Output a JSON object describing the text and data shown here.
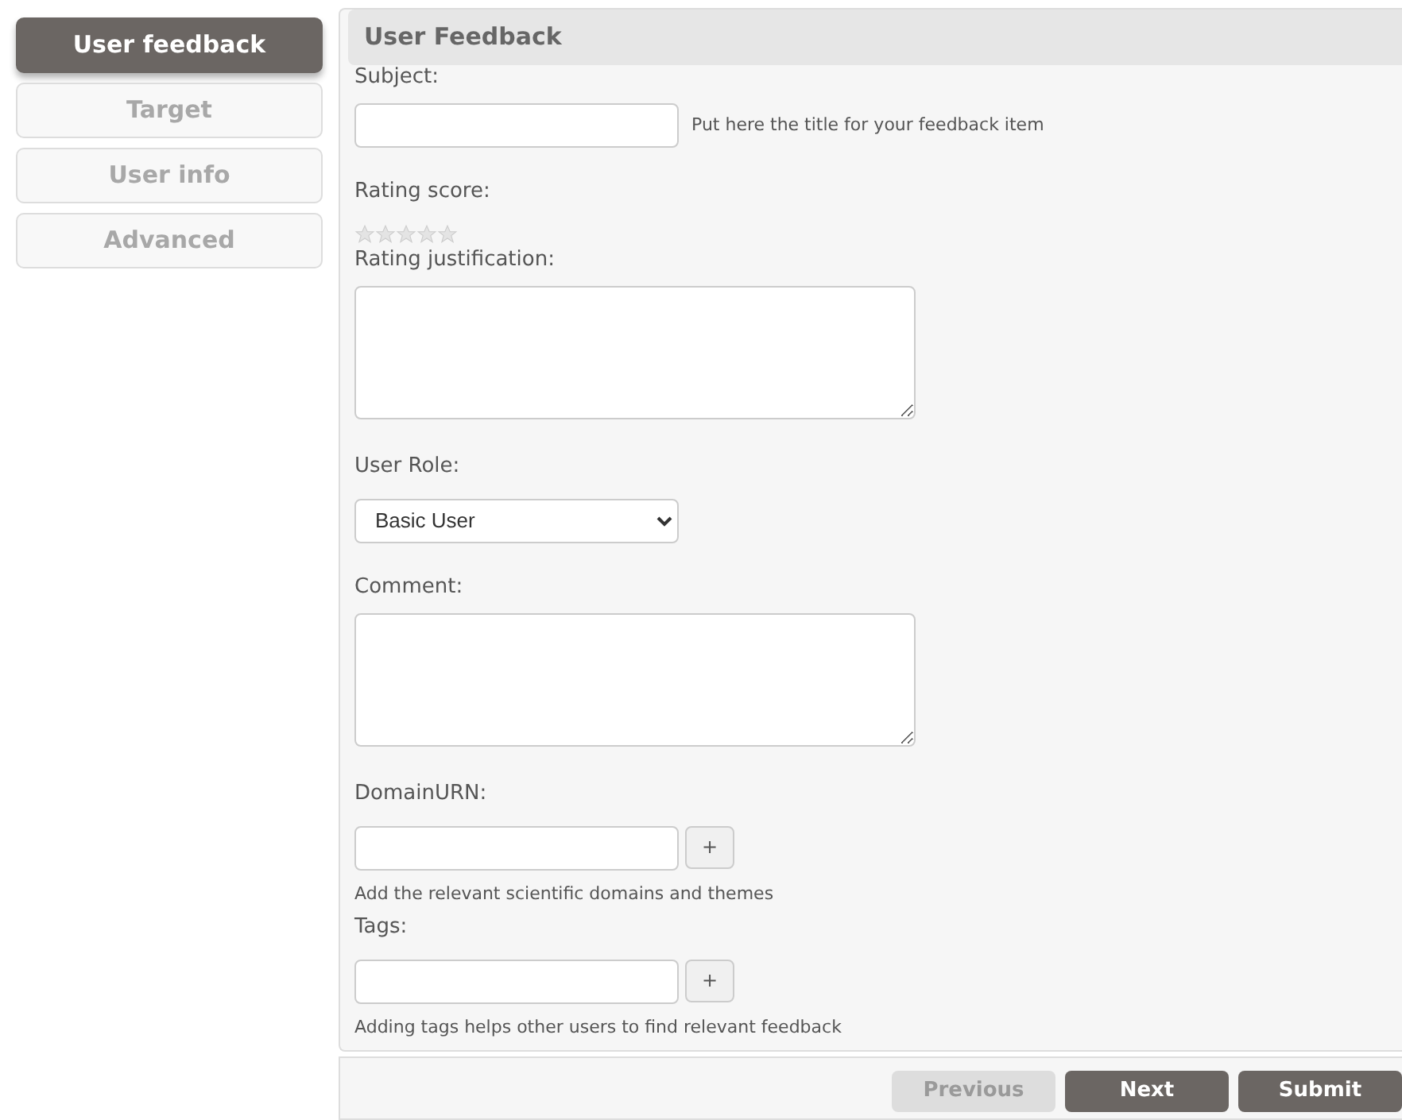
{
  "steps": [
    {
      "label": "User feedback",
      "selected": true
    },
    {
      "label": "Target",
      "selected": false
    },
    {
      "label": "User info",
      "selected": false
    },
    {
      "label": "Advanced",
      "selected": false
    }
  ],
  "panel": {
    "title": "User Feedback"
  },
  "fields": [
    {
      "kind": "text",
      "label": "Subject:",
      "hint": "Put here the title for your feedback item"
    },
    {
      "kind": "stars",
      "label": "Rating score:",
      "stars": 0
    },
    {
      "kind": "textarea",
      "label": "Rating justification:"
    },
    {
      "kind": "select",
      "label": "User Role:",
      "value": "Basic User"
    },
    {
      "kind": "textarea",
      "label": "Comment:"
    },
    {
      "kind": "add",
      "label": "DomainURN:",
      "button": "+",
      "help": "Add the relevant scientific domains and themes"
    },
    {
      "kind": "add",
      "label": "Tags:",
      "button": "+",
      "help": "Adding tags helps other users to find relevant feedback"
    }
  ],
  "buttons": [
    {
      "label": "Previous",
      "disabled": true
    },
    {
      "label": "Next",
      "disabled": false
    },
    {
      "label": "Submit",
      "disabled": false
    }
  ]
}
